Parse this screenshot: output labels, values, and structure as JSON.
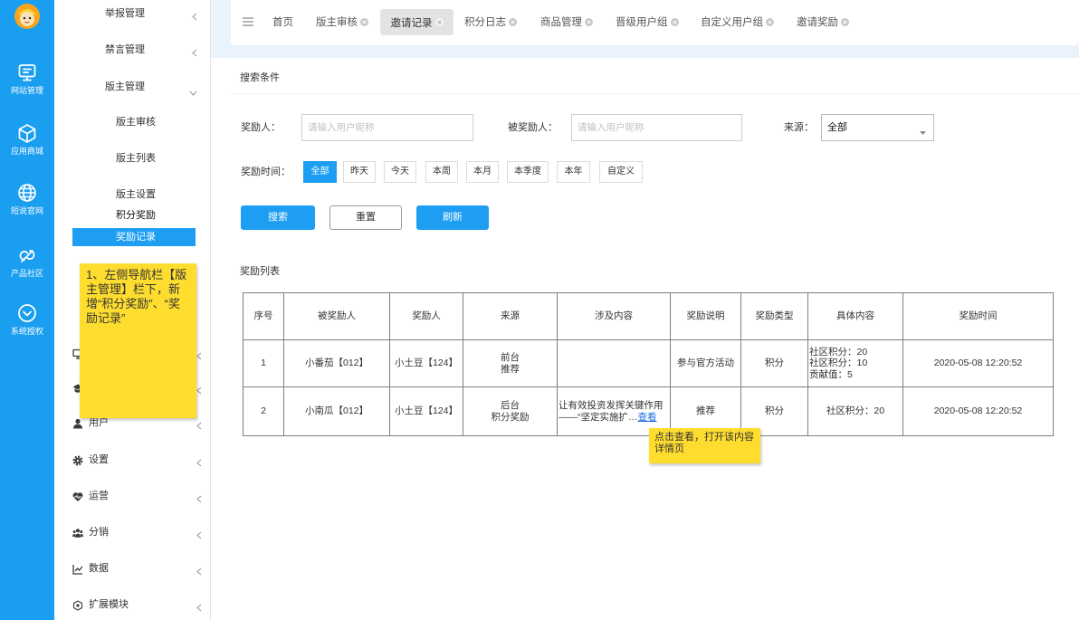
{
  "theme": {
    "sidebar_bg": "#1a9ef0",
    "accent": "#1e9ef2",
    "note_bg": "#fedd2f",
    "link": "#1a6fe0",
    "active_tab_bg": "#e3e3e3"
  },
  "icon_sidebar": {
    "avatar_icon": "cartoon-avatar-icon",
    "items": [
      {
        "icon": "monitor-icon",
        "label": "网站管理",
        "active": true
      },
      {
        "icon": "cube-icon",
        "label": "应用商城"
      },
      {
        "icon": "globe-icon",
        "label": "短说官网"
      },
      {
        "icon": "cloud-icon",
        "label": "产品社区"
      },
      {
        "icon": "check-circle-icon",
        "label": "系统授权"
      }
    ]
  },
  "menu": {
    "groups_top": [
      {
        "label": "举报管理",
        "expanded": false
      },
      {
        "label": "禁言管理",
        "expanded": false
      },
      {
        "label": "版主管理",
        "expanded": true
      }
    ],
    "moderator_sub": [
      {
        "label": "版主审核"
      },
      {
        "label": "版主列表"
      },
      {
        "label": "版主设置"
      },
      {
        "label": "积分奖励"
      },
      {
        "label": "奖励记录",
        "active": true
      }
    ],
    "hidden_groups": [
      {
        "icon": "monitor-icon"
      },
      {
        "icon": "graduation-cap-icon"
      }
    ],
    "groups_bottom": [
      {
        "icon": "user-icon",
        "label": "用户"
      },
      {
        "icon": "gear-icon",
        "label": "设置"
      },
      {
        "icon": "heart-icon",
        "label": "运营"
      },
      {
        "icon": "group-icon",
        "label": "分销"
      },
      {
        "icon": "chart-icon",
        "label": "数据"
      },
      {
        "icon": "extension-icon",
        "label": "扩展模块"
      }
    ]
  },
  "annotations": {
    "menu_note": "1、左侧导航栏【版主管理】栏下，新增“积分奖励”、“奖励记录”",
    "view_note": "点击查看，打开该内容详情页"
  },
  "tabs": {
    "menu_icon": "hamburger-icon",
    "home": "首页",
    "items": [
      {
        "label": "版主审核"
      },
      {
        "label": "邀请记录",
        "active": true
      },
      {
        "label": "积分日志"
      },
      {
        "label": "商品管理"
      },
      {
        "label": "晋级用户组"
      },
      {
        "label": "自定义用户组"
      },
      {
        "label": "邀请奖励"
      }
    ]
  },
  "search": {
    "title": "搜索条件",
    "rewarder_label": "奖励人：",
    "rewarder_placeholder": "请输入用户昵称",
    "rewardee_label": "被奖励人：",
    "rewardee_placeholder": "请输入用户昵称",
    "source_label": "来源：",
    "source_value": "全部",
    "time_label": "奖励时间：",
    "time_options": [
      "全部",
      "昨天",
      "今天",
      "本周",
      "本月",
      "本季度",
      "本年",
      "自定义"
    ],
    "time_selected_index": 0,
    "search_button": "搜索",
    "reset_button": "重置",
    "refresh_button": "刷新"
  },
  "list": {
    "title": "奖励列表",
    "columns": [
      "序号",
      "被奖励人",
      "奖励人",
      "来源",
      "涉及内容",
      "奖励说明",
      "奖励类型",
      "具体内容",
      "奖励时间"
    ],
    "rows": [
      {
        "index": "1",
        "rewardee": "小番茄【012】",
        "rewarder": "小土豆【124】",
        "source": "前台\n推荐",
        "description": "参与官方活动",
        "type": "积分",
        "details": "社区积分：20\n社区积分：10\n贡献值：5",
        "time": "2020-05-08 12:20:52"
      },
      {
        "index": "2",
        "rewardee": "小南瓜【012】",
        "rewarder": "小土豆【124】",
        "source": "后台\n积分奖励",
        "content": "让有效投资发挥关键作用\n——“坚定实施扩…",
        "content_link": "查看",
        "description": "推荐",
        "type": "积分",
        "details": "社区积分：20",
        "time": "2020-05-08 12:20:52"
      }
    ]
  }
}
